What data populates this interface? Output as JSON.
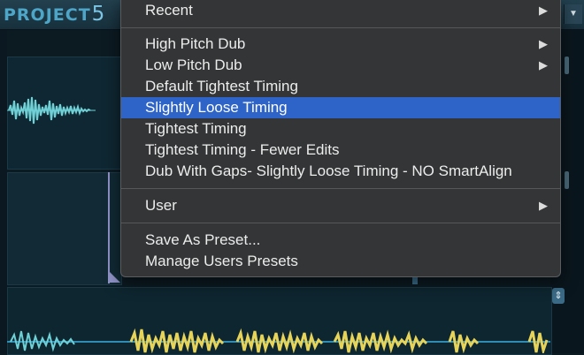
{
  "app": {
    "logo_text": "PROJECT",
    "logo_number": "5",
    "dropdown_glyph": "▼",
    "scroll_glyph": "⇕",
    "colors": {
      "waveform_cyan": "#6fd0d6",
      "waveform_yellow": "#e6d35a",
      "menu_bg": "#333536",
      "menu_highlight": "#2e63c8"
    }
  },
  "menu": {
    "submenu_glyph": "▶",
    "items": [
      {
        "label": "Recent",
        "has_submenu": true
      },
      {
        "label": "High Pitch Dub",
        "has_submenu": true
      },
      {
        "label": "Low Pitch Dub",
        "has_submenu": true
      },
      {
        "label": "Default Tightest Timing",
        "has_submenu": false
      },
      {
        "label": "Slightly Loose Timing",
        "has_submenu": false,
        "highlighted": true
      },
      {
        "label": "Tightest Timing",
        "has_submenu": false
      },
      {
        "label": "Tightest Timing - Fewer Edits",
        "has_submenu": false
      },
      {
        "label": "Dub With Gaps- Slightly Loose Timing - NO SmartAlign",
        "has_submenu": false
      },
      {
        "label": "User",
        "has_submenu": true
      },
      {
        "label": "Save As Preset...",
        "has_submenu": false
      },
      {
        "label": "Manage Users Presets",
        "has_submenu": false
      }
    ]
  }
}
